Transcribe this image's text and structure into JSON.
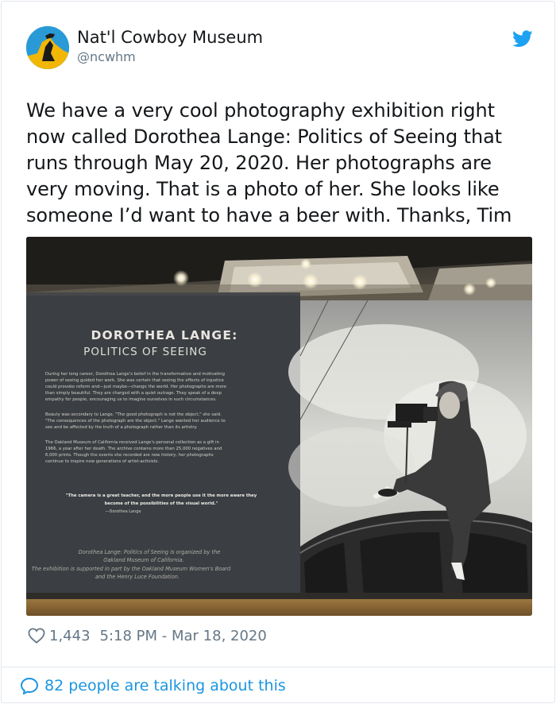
{
  "account": {
    "display_name": "Nat'l Cowboy Museum",
    "handle": "@ncwhm",
    "avatar_icon": "museum-logo-avatar",
    "platform_icon": "twitter-bird-icon"
  },
  "tweet": {
    "text_lines": [
      "We have a very cool photography exhibition right",
      "now called Dorothea Lange: Politics of Seeing that",
      "runs through May 20, 2020. Her photographs are",
      "very moving. That is a photo of her. She looks like",
      "someone I’d want to have a beer with. Thanks, Tim"
    ]
  },
  "photo": {
    "panel_title_1": "DOROTHEA LANGE:",
    "panel_title_2": "POLITICS OF SEEING",
    "para1": [
      "During her long career, Dorothea Lange's belief in the transformative and motivating",
      "power of seeing guided her work. She was certain that seeing the effects of injustice",
      "could provoke reform and—just maybe—change the world. Her photographs are more",
      "than simply beautiful. They are charged with a quiet outrage. They speak of a deep",
      "empathy for people, encouraging us to imagine ourselves in such circumstances."
    ],
    "para2": [
      "Beauty was secondary to Lange. \"The good photograph is not the object,\" she said.",
      "\"The consequences of the photograph are the object.\" Lange wanted her audience to",
      "see and be affected by the truth of a photograph rather than its artistry."
    ],
    "para3": [
      "The Oakland Museum of California received Lange's personal collection as a gift in",
      "1966, a year after her death. The archive contains more than 25,000 negatives and",
      "6,000 prints. Though the events she recorded are now history, her photographs",
      "continue to inspire new generations of artist-activists."
    ],
    "quote": [
      "\"The camera is a great teacher, and the more people use it the more aware they",
      "become of the possibilities of the visual world.\""
    ],
    "quote_attr": "—Dorothea Lange",
    "credits": [
      "Dorothea Lange: Politics of Seeing is organized by the",
      "Oakland Museum of California.",
      "The exhibition is supported in part by the Oakland Museum Women's Board",
      "and the Henry Luce Foundation."
    ]
  },
  "meta": {
    "likes": "1,443",
    "timestamp": "5:18 PM - Mar 18, 2020",
    "heart_icon": "heart-icon"
  },
  "footer": {
    "talking": "82 people are talking about this",
    "bubble_icon": "speech-bubble-icon"
  },
  "colors": {
    "link_blue": "#1b95e0",
    "secondary_gray": "#657786",
    "text": "#14171a"
  }
}
